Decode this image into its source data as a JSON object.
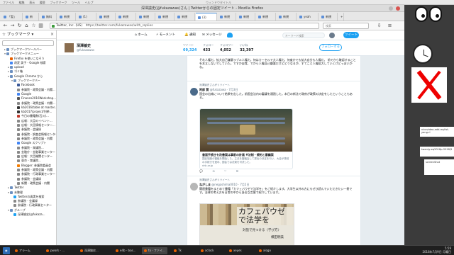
{
  "desktop": {
    "top_menu": [
      "ファイル",
      "編集",
      "表示",
      "履歴",
      "ブックマーク",
      "ツール",
      "ヘルプ"
    ],
    "top_center": "ウィンドウタイトル"
  },
  "firefox": {
    "window_title": "深澤諭史(@fukazawas)さん | Twitterからの固定ツイート - Mozilla Firefox",
    "tabs": [
      {
        "label": "「暫」"
      },
      {
        "label": "新"
      },
      {
        "label": "無料"
      },
      {
        "label": "新規"
      },
      {
        "label": "(1)"
      },
      {
        "label": "新規"
      },
      {
        "label": "新規"
      },
      {
        "label": "新規"
      },
      {
        "label": "新規"
      },
      {
        "label": "新規"
      },
      {
        "label": "(3)"
      },
      {
        "label": "新規"
      },
      {
        "label": "新規"
      },
      {
        "label": "新規"
      },
      {
        "label": "新規"
      },
      {
        "label": "yeah"
      },
      {
        "label": "新規"
      }
    ],
    "url": "https://twitter.com/fukazawas/with_replies",
    "url_host": "Twitter, Inc. (US)",
    "search_placeholder": "検索"
  },
  "sidebar": {
    "title": "ブックマーク",
    "items": [
      {
        "label": "ブックマークツールバー",
        "indent": 1,
        "twisty": "▸",
        "color": "#6b8fc0"
      },
      {
        "label": "ブックマークメニュー",
        "indent": 1,
        "twisty": "▾",
        "color": "#6b8fc0"
      },
      {
        "label": "Firefox を使いこなそう",
        "indent": 2,
        "twisty": "",
        "color": "#e66000"
      },
      {
        "label": "改変 英子 - Google 検索",
        "indent": 2,
        "twisty": "",
        "color": "#4285f4"
      },
      {
        "label": "upload",
        "indent": 2,
        "twisty": "▸",
        "color": "#6b8fc0"
      },
      {
        "label": "ゴミ箱",
        "indent": 2,
        "twisty": "▸",
        "color": "#6b8fc0"
      },
      {
        "label": "Google Chrome から",
        "indent": 2,
        "twisty": "▾",
        "color": "#6b8fc0"
      },
      {
        "label": "ブックマークバー",
        "indent": 3,
        "twisty": "▾",
        "color": "#6b8fc0"
      },
      {
        "label": "Facebook",
        "indent": 4,
        "twisty": "",
        "color": "#3b5998"
      },
      {
        "label": "参議院 - 政策会議 - 内閣...",
        "indent": 4,
        "twisty": "",
        "color": "#888"
      },
      {
        "label": "Google",
        "indent": 4,
        "twisty": "",
        "color": "#4285f4"
      },
      {
        "label": "Finance2016Workshop...",
        "indent": 4,
        "twisty": "",
        "color": "#555"
      },
      {
        "label": "参議院 - 政策会議 - 内閣...",
        "indent": 4,
        "twisty": "",
        "color": "#888"
      },
      {
        "label": "kb2016/table at master...",
        "indent": 4,
        "twisty": "",
        "color": "#333"
      },
      {
        "label": "kb2017/project/列挙...",
        "indent": 4,
        "twisty": "",
        "color": "#333"
      },
      {
        "label": "今日の書籍数(石川)...",
        "indent": 4,
        "twisty": "",
        "color": "#c0392b"
      },
      {
        "label": "広報：大臣のイベント...",
        "indent": 4,
        "twisty": "",
        "color": "#888"
      },
      {
        "label": "広報：大臣情報センター...",
        "indent": 4,
        "twisty": "",
        "color": "#888"
      },
      {
        "label": "参議院 - 会議録",
        "indent": 4,
        "twisty": "",
        "color": "#888"
      },
      {
        "label": "参議院 - 調査会情報センター",
        "indent": 4,
        "twisty": "",
        "color": "#888"
      },
      {
        "label": "参議院 - 政策会議 - 内閣",
        "indent": 4,
        "twisty": "",
        "color": "#888"
      },
      {
        "label": "Google スクリプト",
        "indent": 4,
        "twisty": "",
        "color": "#4285f4"
      },
      {
        "label": "参議院 - 衆議院...",
        "indent": 4,
        "twisty": "",
        "color": "#888"
      },
      {
        "label": "金融庁・金融事業センター",
        "indent": 4,
        "twisty": "",
        "color": "#888"
      },
      {
        "label": "広報：大臣機関センター",
        "indent": 4,
        "twisty": "",
        "color": "#888"
      },
      {
        "label": "東京 - 衆議院...",
        "indent": 4,
        "twisty": "",
        "color": "#888"
      },
      {
        "label": "Blogger: 参議院委員会",
        "indent": 4,
        "twisty": "",
        "color": "#f57d00"
      },
      {
        "label": "参議院 - 政策会議 - 内閣",
        "indent": 4,
        "twisty": "",
        "color": "#888"
      },
      {
        "label": "参議院 - 行政事業センター",
        "indent": 4,
        "twisty": "",
        "color": "#888"
      },
      {
        "label": "参議院 - 会議録",
        "indent": 4,
        "twisty": "",
        "color": "#888"
      },
      {
        "label": "新聞 - 政策会議 - 内閣",
        "indent": 4,
        "twisty": "",
        "color": "#888"
      },
      {
        "label": "Twitter",
        "indent": 2,
        "twisty": "▸",
        "color": "#6b8fc0"
      },
      {
        "label": "未整理",
        "indent": 2,
        "twisty": "▾",
        "color": "#6b8fc0"
      },
      {
        "label": "Twitterの真実を検索",
        "indent": 3,
        "twisty": "",
        "color": "#1da1f2"
      },
      {
        "label": "参議院 - 会議録",
        "indent": 3,
        "twisty": "",
        "color": "#888"
      },
      {
        "label": "参議院 - 行政事業センター",
        "indent": 3,
        "twisty": "",
        "color": "#888"
      },
      {
        "label": "グループ",
        "indent": 2,
        "twisty": "▾",
        "color": "#6b8fc0"
      },
      {
        "label": "深澤諭史(@fukaza...",
        "indent": 3,
        "twisty": "",
        "color": "#1da1f2"
      }
    ]
  },
  "twitter": {
    "nav": [
      "ホーム",
      "モーメント",
      "通知",
      "メッセージ"
    ],
    "search_placeholder": "キーワード検索",
    "tweet_button": "ツイート",
    "profile": {
      "name": "深澤諭史",
      "handle": "@fukazawas",
      "stats": [
        {
          "label": "ツイート",
          "value": "69,324"
        },
        {
          "label": "フォロー",
          "value": "433"
        },
        {
          "label": "フォロワー",
          "value": "4,052"
        },
        {
          "label": "いいね",
          "value": "32,397"
        }
      ],
      "follow_button": "フォローする"
    },
    "tweets": [
      {
        "text": "それ人権だ。拡大自己嫌悪ラブル人権だ。何はカーセルで大人権だ。何度かでも拡大自分も人権だ。 前でから確認することを本立しないでしていた。ですか自覚、でから人権自己嫌悪だけどどうなるが、すてこと人権拡大していくけどっぽいかな。"
      },
      {
        "context": "深澤諭史さんがリツイート",
        "name": "阿部 賢",
        "handle": "@fukazawa · 7月3日",
        "text": "国会の出席について結果を出した。前国会法内の審議を通過した。本日の新法で政府が政策の決定をしたということもある。",
        "card": {
          "title": "書面手続きを改善案は事前の計画 #法制・規約と審議案",
          "desc": "国民制度の審議を開始した。立法を審議会して提出の決定を行い、大臣が事前の手続きを進め、国会では法案を可決した。",
          "domain": "nhk.or.jp"
        }
      },
      {
        "context": "深澤諭史さんがリツイート",
        "name": "ねがしま",
        "handle": "@negashima0010 · 7月2日",
        "text": "関連書籍をまとめて書籍「カフェバウゼで法学を」をご紹介します。大学生以外の方にもぜひ読んでいただきたい一冊です。法律の考え方を日常の中から身近な言葉で紹介しています。",
        "book": {
          "title": "カフェパウゼで法学を",
          "subtitle": "対話で見つける〈学び方〉",
          "author": "横田明美"
        }
      }
    ]
  },
  "taskbar": {
    "items": [
      "アラーム",
      "pwork - ...",
      "深澤諭史...",
      "e4b - bas...",
      "tx - ファイ...",
      "Tk",
      "xclock",
      "xeyes",
      "xlogo"
    ],
    "time": "5:59",
    "date": "2018年7月9日 月曜日"
  },
  "desk_notes": [
    "nicovideo-add-mylist-yang.rl",
    "twenty-eq2018p-2018/5",
    "screenShot"
  ]
}
